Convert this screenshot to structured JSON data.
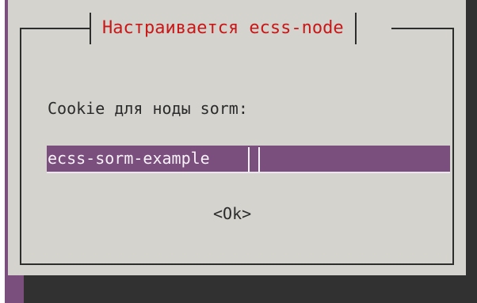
{
  "dialog": {
    "title": "Настраивается ecss-node",
    "prompt": "Cookie для ноды sorm:",
    "input_value": "ecss-sorm-example",
    "ok_label": "<Ok>"
  },
  "colors": {
    "background": "#7a4f7d",
    "dialog": "#d4d3ce",
    "shadow": "#313131",
    "title": "#c81818",
    "input": "#7a4f7d",
    "text": "#2b2b2b"
  }
}
